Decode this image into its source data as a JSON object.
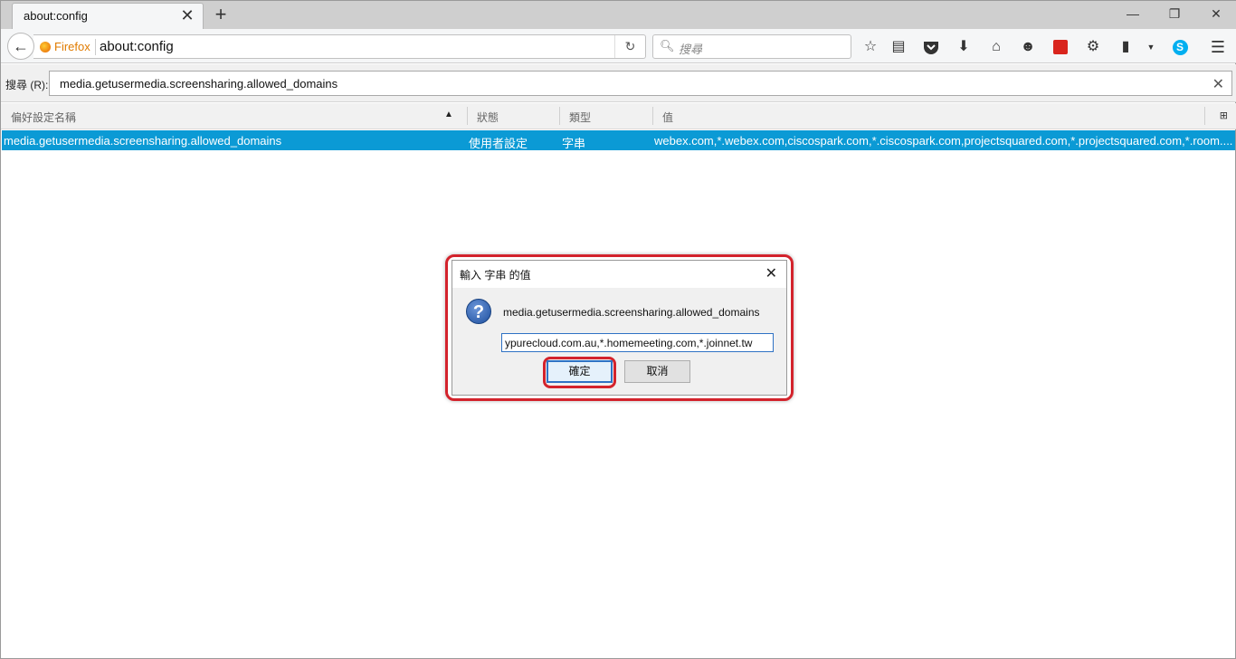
{
  "browser": {
    "tab_title": "about:config",
    "tab_close": "✕",
    "new_tab": "+",
    "window_controls": [
      "—",
      "❐",
      "✕"
    ]
  },
  "navbar": {
    "back": "←",
    "identity_label": "Firefox",
    "url": "about:config",
    "reload": "↻",
    "search_placeholder": "搜尋",
    "toolbar_icons": [
      "star-icon",
      "reading-list-icon",
      "pocket-icon",
      "download-icon",
      "home-icon",
      "emoji-icon",
      "acrobat-icon",
      "extension-icon",
      "clipboard-icon",
      "dropdown-icon",
      "skype-icon",
      "menu-icon"
    ]
  },
  "filter": {
    "label": "搜尋 (R):",
    "value": "media.getusermedia.screensharing.allowed_domains",
    "clear": "✕"
  },
  "table": {
    "headers": [
      "偏好設定名稱",
      "狀態",
      "類型",
      "值"
    ],
    "rows": [
      {
        "name": "media.getusermedia.screensharing.allowed_domains",
        "status": "使用者設定",
        "type": "字串",
        "value": "webex.com,*.webex.com,ciscospark.com,*.ciscospark.com,projectsquared.com,*.projectsquared.com,*.room...."
      }
    ]
  },
  "dialog": {
    "title": "輸入 字串 的值",
    "close": "✕",
    "message": "media.getusermedia.screensharing.allowed_domains",
    "input_value": "ypurecloud.com.au,*.homemeeting.com,*.joinnet.tw",
    "ok_label": "確定",
    "cancel_label": "取消"
  },
  "colors": {
    "selection": "#0b9ad5",
    "highlight_outline": "#d3232c",
    "focus": "#2f72c4"
  }
}
